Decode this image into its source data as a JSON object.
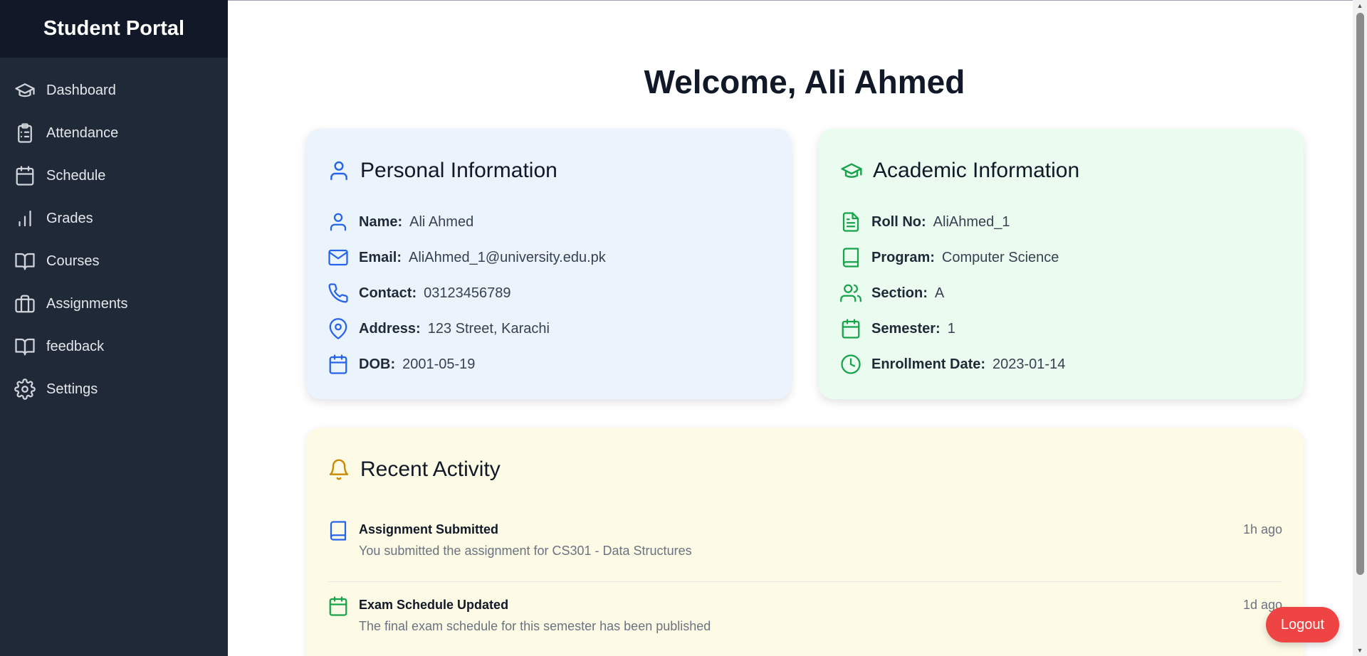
{
  "app": {
    "brand": "Student Portal"
  },
  "sidebar": {
    "items": [
      {
        "label": "Dashboard",
        "icon": "graduation-cap-icon"
      },
      {
        "label": "Attendance",
        "icon": "clipboard-list-icon"
      },
      {
        "label": "Schedule",
        "icon": "calendar-icon"
      },
      {
        "label": "Grades",
        "icon": "bar-chart-icon"
      },
      {
        "label": "Courses",
        "icon": "book-open-icon"
      },
      {
        "label": "Assignments",
        "icon": "briefcase-icon"
      },
      {
        "label": "feedback",
        "icon": "book-open-icon"
      },
      {
        "label": "Settings",
        "icon": "gear-icon"
      }
    ]
  },
  "main": {
    "welcome": "Welcome, Ali Ahmed",
    "personal": {
      "title": "Personal Information",
      "rows": [
        {
          "label": "Name:",
          "value": "Ali Ahmed",
          "icon": "user-icon"
        },
        {
          "label": "Email:",
          "value": "AliAhmed_1@university.edu.pk",
          "icon": "mail-icon"
        },
        {
          "label": "Contact:",
          "value": "03123456789",
          "icon": "phone-icon"
        },
        {
          "label": "Address:",
          "value": "123 Street, Karachi",
          "icon": "map-pin-icon"
        },
        {
          "label": "DOB:",
          "value": "2001-05-19",
          "icon": "calendar-icon"
        }
      ]
    },
    "academic": {
      "title": "Academic Information",
      "rows": [
        {
          "label": "Roll No:",
          "value": "AliAhmed_1",
          "icon": "file-text-icon"
        },
        {
          "label": "Program:",
          "value": "Computer Science",
          "icon": "book-icon"
        },
        {
          "label": "Section:",
          "value": "A",
          "icon": "users-icon"
        },
        {
          "label": "Semester:",
          "value": "1",
          "icon": "calendar-icon"
        },
        {
          "label": "Enrollment Date:",
          "value": "2023-01-14",
          "icon": "clock-icon"
        }
      ]
    },
    "activity": {
      "title": "Recent Activity",
      "items": [
        {
          "title": "Assignment Submitted",
          "desc": "You submitted the assignment for CS301 - Data Structures",
          "time": "1h ago",
          "icon": "book-icon"
        },
        {
          "title": "Exam Schedule Updated",
          "desc": "The final exam schedule for this semester has been published",
          "time": "1d ago",
          "icon": "calendar-icon"
        }
      ]
    },
    "logout_label": "Logout"
  },
  "colors": {
    "sidebar_bg": "#1f2937",
    "brand_bg": "#111827",
    "personal_bg": "#ebf3fd",
    "academic_bg": "#eafbf0",
    "activity_bg": "#fdfbe6",
    "blue_icon": "#2563eb",
    "green_icon": "#16a34a",
    "amber_icon": "#ca8a04",
    "logout": "#ef4444"
  }
}
